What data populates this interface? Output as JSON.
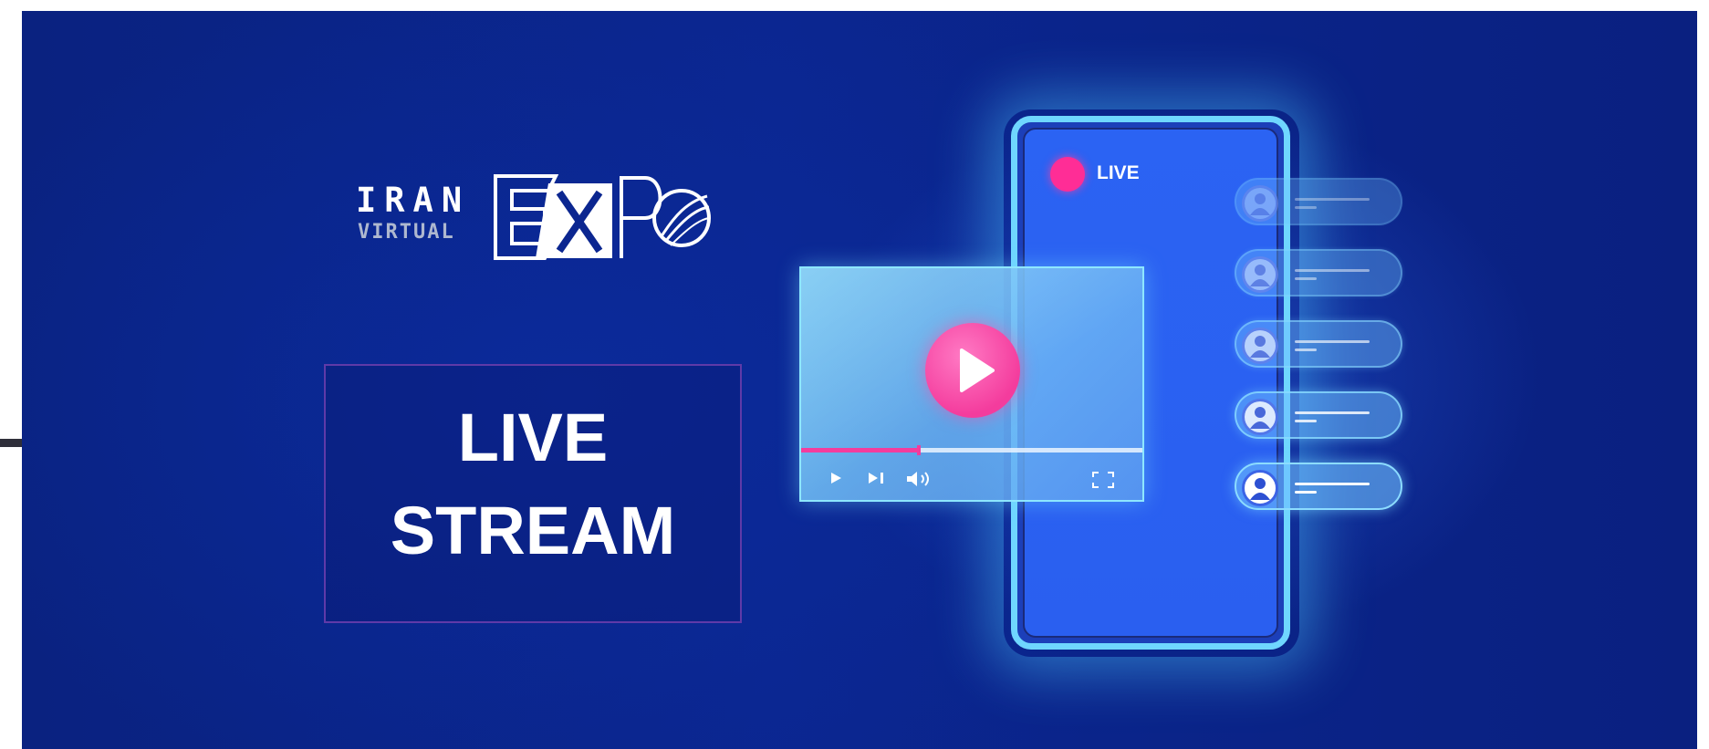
{
  "logo": {
    "line1": "IRAN",
    "line2": "VIRTUAL",
    "mark_letters": "EXPO",
    "icon": "globe-arc-icon"
  },
  "headline": {
    "line1": "LIVE",
    "line2": "STREAM"
  },
  "phone": {
    "live_label": "LIVE",
    "live_dot_color": "#ff2d96"
  },
  "video_player": {
    "progress_fraction": 0.34,
    "controls": [
      "play-icon",
      "skip-next-icon",
      "volume-icon",
      "fullscreen-icon"
    ],
    "play_button_color": "#f43c9d"
  },
  "comments": [
    {
      "opacity": 0.18
    },
    {
      "opacity": 0.35
    },
    {
      "opacity": 0.55
    },
    {
      "opacity": 0.78
    },
    {
      "opacity": 1.0
    }
  ],
  "colors": {
    "background": "#0a2387",
    "phone_border": "#6fd6ff",
    "phone_screen": "#2b63f3",
    "accent_pink": "#f43c9d",
    "title_border": "#5f3aa8"
  }
}
